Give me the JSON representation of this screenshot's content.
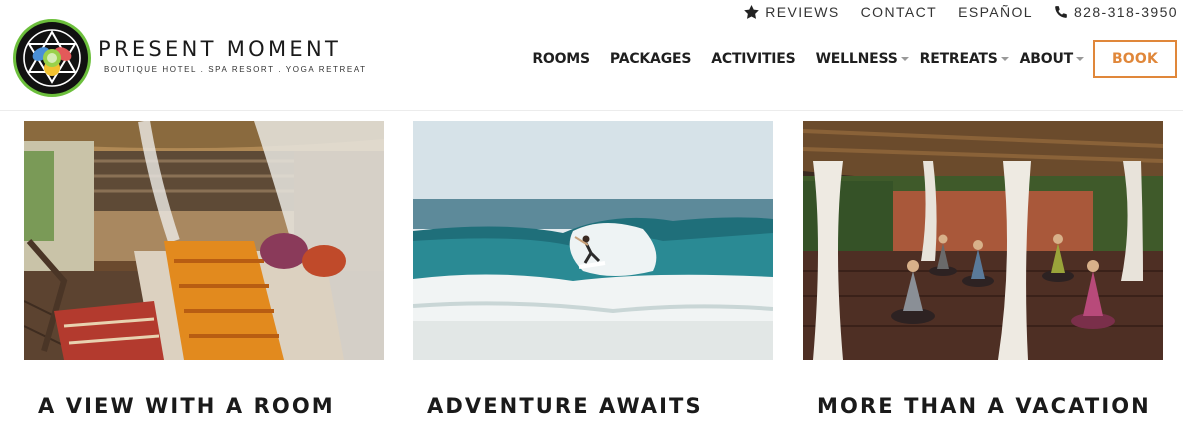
{
  "utility": {
    "reviews": "REVIEWS",
    "contact": "CONTACT",
    "espanol": "ESPAÑOL",
    "phone": "828-318-3950"
  },
  "logo": {
    "title": "PRESENT MOMENT",
    "subtitle": "BOUTIQUE HOTEL . SPA RESORT . YOGA RETREAT"
  },
  "nav": {
    "items": [
      {
        "label": "ROOMS",
        "dropdown": false
      },
      {
        "label": "PACKAGES",
        "dropdown": false
      },
      {
        "label": "ACTIVITIES",
        "dropdown": false
      },
      {
        "label": "WELLNESS",
        "dropdown": true
      },
      {
        "label": "RETREATS",
        "dropdown": true
      },
      {
        "label": "ABOUT",
        "dropdown": true
      }
    ],
    "book": "BOOK"
  },
  "colors": {
    "accent": "#e0873a",
    "text": "#1a1a1a",
    "logo_ring": "#6cbf3c"
  },
  "cards": [
    {
      "title": "A VIEW WITH A ROOM",
      "image": "bedroom-photo"
    },
    {
      "title": "ADVENTURE AWAITS",
      "image": "surfer-photo"
    },
    {
      "title": "MORE THAN A VACATION",
      "image": "yoga-class-photo"
    }
  ]
}
